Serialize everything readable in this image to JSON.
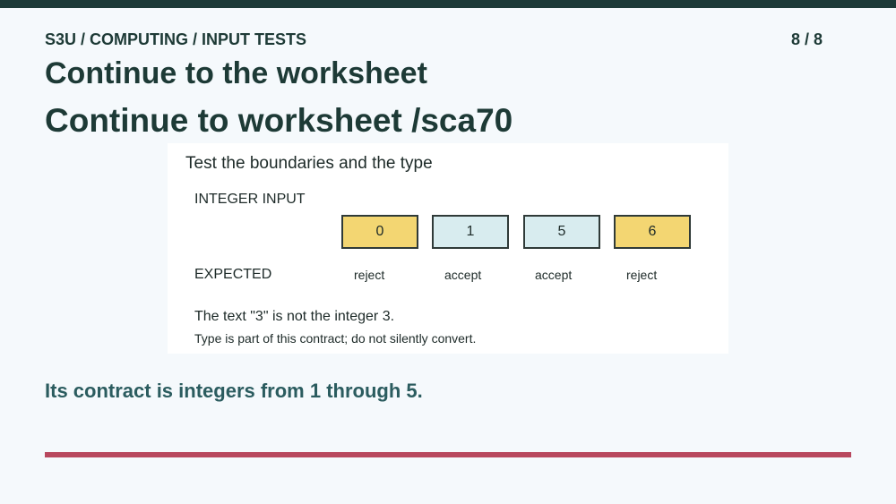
{
  "header": {
    "breadcrumb": "S3U / COMPUTING / INPUT TESTS",
    "page_counter": "8 / 8"
  },
  "slide": {
    "title": "Continue to the worksheet",
    "subtitle": "Continue to worksheet /sca70"
  },
  "card": {
    "heading": "Test the boundaries and the type",
    "input_label": "INTEGER INPUT",
    "expected_label": "EXPECTED",
    "cases": [
      {
        "value": "0",
        "expected": "reject"
      },
      {
        "value": "1",
        "expected": "accept"
      },
      {
        "value": "5",
        "expected": "accept"
      },
      {
        "value": "6",
        "expected": "reject"
      }
    ],
    "note_main": "The text \"3\" is not the integer 3.",
    "note_sub": "Type is part of this contract; do not silently convert."
  },
  "footer": {
    "contract": "Its contract is integers from 1 through 5."
  },
  "colors": {
    "dark": "#1d3a38",
    "reject_fill": "#f3d672",
    "accept_fill": "#d8ecef",
    "accent_rule": "#b8485e",
    "contract_text": "#2b5c5f"
  }
}
